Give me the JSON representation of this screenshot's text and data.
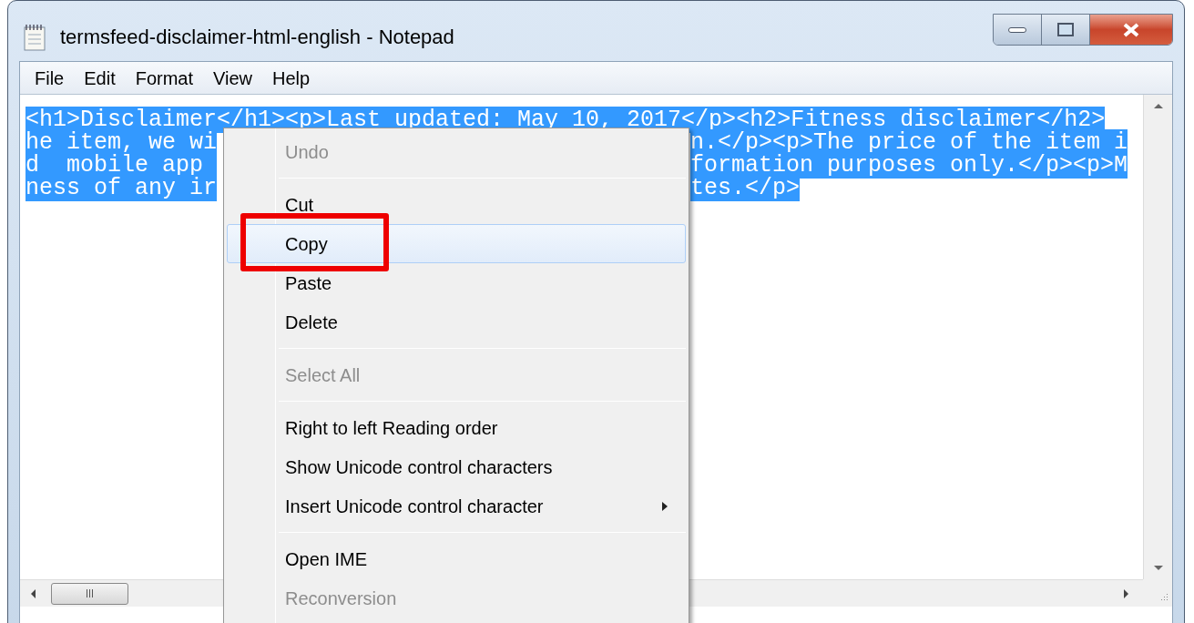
{
  "window": {
    "title": "termsfeed-disclaimer-html-english - Notepad"
  },
  "menu_bar": [
    "File",
    "Edit",
    "Format",
    "View",
    "Help"
  ],
  "editor": {
    "selected": true,
    "lines": [
      {
        "left": "<h1>Disclaimer</h1><p>Last updated: May 10, 2017</p><h2>Fitness disclaimer</h2>"
      },
      {
        "left": "he item, we wi",
        "right": "n.</p><p>The price of the item i"
      },
      {
        "left": "d  mobile app ",
        "right": "formation purposes only.</p><p>M"
      },
      {
        "left": "ness of any ir",
        "right": "tes.</p>"
      }
    ]
  },
  "context_menu": {
    "items": [
      {
        "kind": "item",
        "label": "Undo",
        "disabled": true,
        "selected": false,
        "annotated": false,
        "submenu": false
      },
      {
        "kind": "separator"
      },
      {
        "kind": "item",
        "label": "Cut",
        "disabled": false,
        "selected": false,
        "annotated": false,
        "submenu": false
      },
      {
        "kind": "item",
        "label": "Copy",
        "disabled": false,
        "selected": true,
        "annotated": true,
        "submenu": false
      },
      {
        "kind": "item",
        "label": "Paste",
        "disabled": false,
        "selected": false,
        "annotated": false,
        "submenu": false
      },
      {
        "kind": "item",
        "label": "Delete",
        "disabled": false,
        "selected": false,
        "annotated": false,
        "submenu": false
      },
      {
        "kind": "separator"
      },
      {
        "kind": "item",
        "label": "Select All",
        "disabled": true,
        "selected": false,
        "annotated": false,
        "submenu": false
      },
      {
        "kind": "separator"
      },
      {
        "kind": "item",
        "label": "Right to left Reading order",
        "disabled": false,
        "selected": false,
        "annotated": false,
        "submenu": false
      },
      {
        "kind": "item",
        "label": "Show Unicode control characters",
        "disabled": false,
        "selected": false,
        "annotated": false,
        "submenu": false
      },
      {
        "kind": "item",
        "label": "Insert Unicode control character",
        "disabled": false,
        "selected": false,
        "annotated": false,
        "submenu": true
      },
      {
        "kind": "separator"
      },
      {
        "kind": "item",
        "label": "Open IME",
        "disabled": false,
        "selected": false,
        "annotated": false,
        "submenu": false
      },
      {
        "kind": "item",
        "label": "Reconversion",
        "disabled": true,
        "selected": false,
        "annotated": false,
        "submenu": false
      }
    ]
  }
}
